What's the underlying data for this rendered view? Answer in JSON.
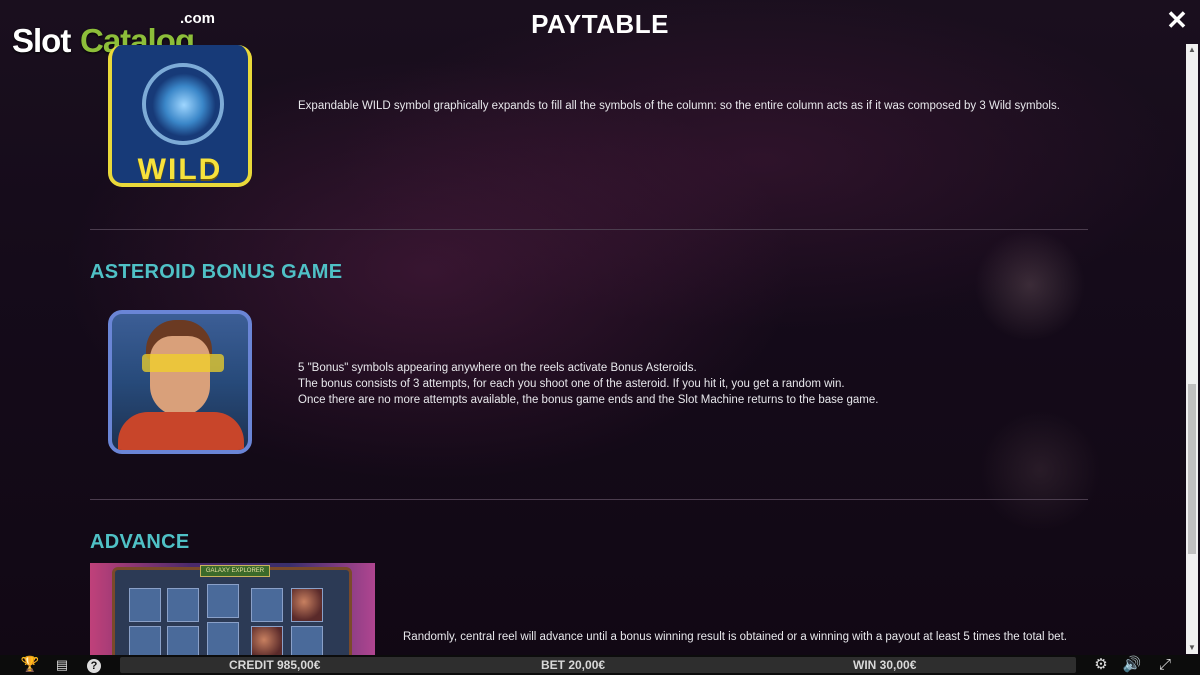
{
  "logo": {
    "part1": "Slot",
    "part2": "Catalog",
    "suffix": ".com"
  },
  "header": {
    "title": "PAYTABLE",
    "close_icon": "close-icon"
  },
  "wild_section": {
    "symbol_label": "WILD",
    "description": "Expandable WILD symbol graphically expands to fill all the symbols of the column: so the entire column acts as if it was composed by 3 Wild symbols."
  },
  "bonus_section": {
    "heading": "ASTEROID BONUS GAME",
    "lines": [
      "5 \"Bonus\" symbols appearing anywhere on the reels activate Bonus Asteroids.",
      "The bonus consists of 3 attempts, for each you shoot one of the asteroid. If you hit it, you get a random win.",
      "Once there are no more attempts available, the bonus game ends and the Slot Machine returns to the base game."
    ]
  },
  "advance_section": {
    "heading": "ADVANCE",
    "preview_banner": "GALAXY EXPLORER",
    "description": "Randomly, central reel will advance until a bonus winning result is obtained or a winning with a payout at least 5 times the total bet."
  },
  "bottom_bar": {
    "credit": "CREDIT 985,00€",
    "bet": "BET 20,00€",
    "win": "WIN 30,00€",
    "icons": [
      "trophy-icon",
      "paytable-icon",
      "help-icon",
      "settings-icon",
      "sound-icon",
      "fullscreen-icon"
    ]
  },
  "colors": {
    "heading": "#4fc1c6",
    "wild_border": "#e9d93a",
    "logo_green": "#8dbe3a"
  }
}
